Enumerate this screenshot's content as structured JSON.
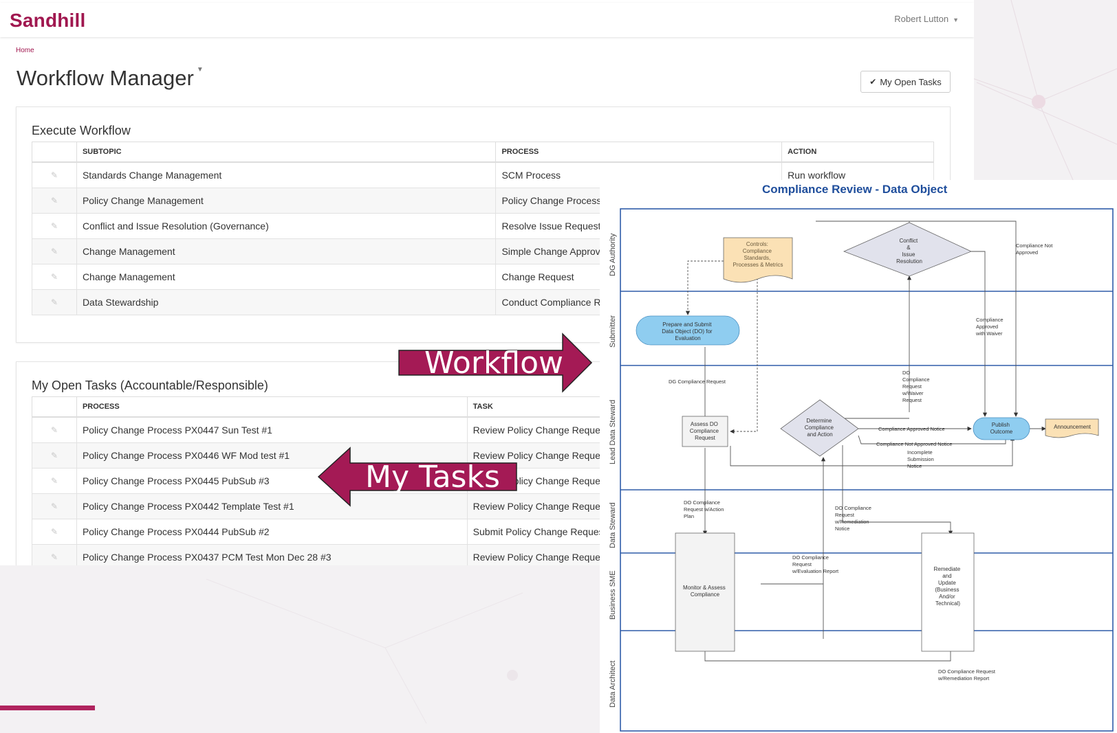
{
  "app": {
    "logo": "Sandhill",
    "user": "Robert Lutton",
    "breadcrumb": "Home",
    "page_title": "Workflow Manager",
    "my_open_tasks_button": "My Open Tasks"
  },
  "execute_workflow": {
    "title": "Execute Workflow",
    "columns": [
      "SUBTOPIC",
      "PROCESS",
      "ACTION"
    ],
    "rows": [
      {
        "subtopic": "Standards Change Management",
        "process": "SCM Process",
        "action": "Run workflow"
      },
      {
        "subtopic": "Policy Change Management",
        "process": "Policy Change Process",
        "action": ""
      },
      {
        "subtopic": "Conflict and Issue Resolution (Governance)",
        "process": "Resolve Issue Request",
        "action": ""
      },
      {
        "subtopic": "Change Management",
        "process": "Simple Change Approval",
        "action": ""
      },
      {
        "subtopic": "Change Management",
        "process": "Change Request",
        "action": ""
      },
      {
        "subtopic": "Data Stewardship",
        "process": "Conduct Compliance Review",
        "action": ""
      }
    ]
  },
  "my_open_tasks": {
    "title": "My Open Tasks (Accountable/Responsible)",
    "columns": [
      "PROCESS",
      "TASK"
    ],
    "rows": [
      {
        "process": "Policy Change Process PX0447 Sun Test #1",
        "task": "Review Policy Change Request"
      },
      {
        "process": "Policy Change Process PX0446 WF Mod test #1",
        "task": "Review Policy Change Request"
      },
      {
        "process": "Policy Change Process PX0445 PubSub #3",
        "task": "Review Policy Change Request"
      },
      {
        "process": "Policy Change Process PX0442 Template Test #1",
        "task": "Review Policy Change Request"
      },
      {
        "process": "Policy Change Process PX0444 PubSub #2",
        "task": "Submit Policy Change Request"
      },
      {
        "process": "Policy Change Process PX0437 PCM Test Mon Dec 28 #3",
        "task": "Review Policy Change Request"
      }
    ]
  },
  "callouts": {
    "workflow": "Workflow",
    "my_tasks": "My Tasks"
  },
  "diagram": {
    "title": "Compliance Review - Data Object",
    "lanes": [
      "DG Authority",
      "Submitter",
      "Lead Data Steward",
      "Data Steward",
      "Business SME",
      "Data Architect"
    ],
    "nodes": {
      "controls": [
        "Controls:",
        "Compliance",
        "Standards,",
        "Processes & Metrics"
      ],
      "conflict": [
        "Conflict",
        "&",
        "Issue",
        "Resolution"
      ],
      "prepare": [
        "Prepare and Submit",
        "Data Object (DO) for",
        "Evaluation"
      ],
      "assess": [
        "Assess DO",
        "Compliance",
        "Request"
      ],
      "determine": [
        "Determine",
        "Compliance",
        "and Action"
      ],
      "publish": [
        "Publish",
        "Outcome"
      ],
      "announcement": "Announcement",
      "monitor": [
        "Monitor & Assess",
        "Compliance"
      ],
      "remediate": [
        "Remediate",
        "and",
        "Update",
        "(Business",
        "And/or",
        "Technical)"
      ]
    },
    "edge_labels": {
      "not_approved": [
        "Compliance Not",
        "Approved"
      ],
      "approved_waiver": [
        "Compliance",
        "Approved",
        "with Waiver"
      ],
      "dg_request": "DG Compliance Request",
      "waiver_request": [
        "DO",
        "Compliance",
        "Request",
        "w/Waiver",
        "Request"
      ],
      "approved_notice": "Compliance Approved Notice",
      "not_approved_notice": "Compliance Not Approved Notice",
      "incomplete": [
        "Incomplete",
        "Submission",
        "Notice"
      ],
      "action_plan": [
        "DO Compliance",
        "Request w/Action",
        "Plan"
      ],
      "remediation_notice": [
        "DO Compliance",
        "Request",
        "w/Remediation",
        "Notice"
      ],
      "evaluation_report": [
        "DO Compliance",
        "Request",
        "w/Evaluation Report"
      ],
      "remediation_report": [
        "DO Compliance Request",
        "w/Remediation Report"
      ]
    }
  },
  "colors": {
    "brand": "#a0174f",
    "callout": "#a41a55",
    "lane_border": "#2e5ba8",
    "diagram_title": "#1f4e9c",
    "rounded_node": "#8fcdf0",
    "document_node": "#fbe1b5",
    "decision_node": "#e1e2ec"
  }
}
